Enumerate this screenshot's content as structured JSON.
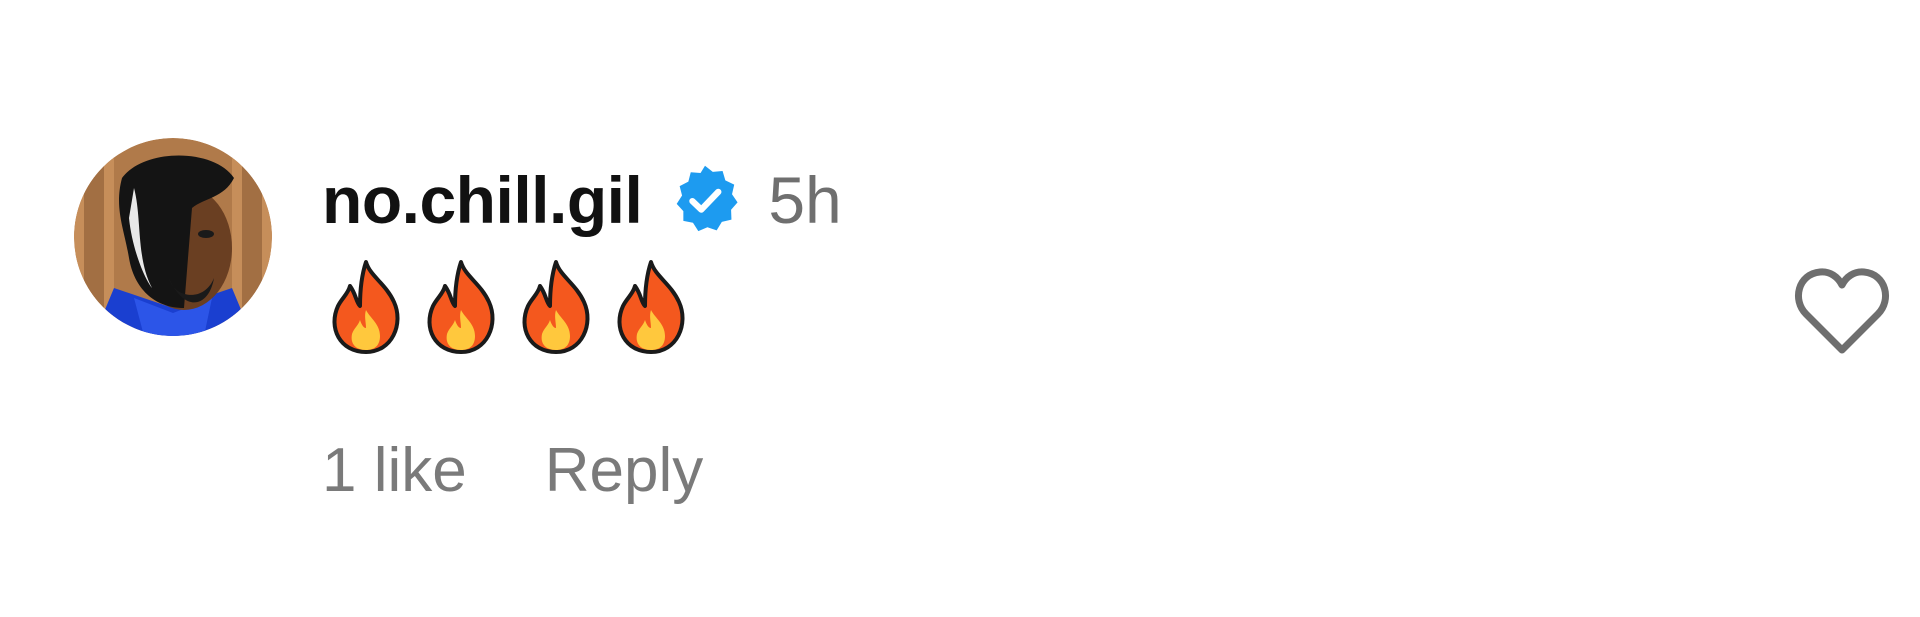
{
  "comment": {
    "username": "no.chill.gil",
    "verified": true,
    "timestamp": "5h",
    "text_emojis": [
      "fire",
      "fire",
      "fire",
      "fire"
    ],
    "like_count_label": "1 like",
    "reply_label": "Reply",
    "liked": false
  },
  "icons": {
    "verified": "verified-badge-icon",
    "emoji": "fire-emoji-icon",
    "like": "heart-outline-icon"
  },
  "colors": {
    "username": "#111111",
    "muted_text": "#7a7a7a",
    "verified_blue": "#1d9bf0",
    "heart_outline": "#6e6e6e",
    "fire_outer": "#f4581e",
    "fire_inner": "#ffc83d"
  }
}
